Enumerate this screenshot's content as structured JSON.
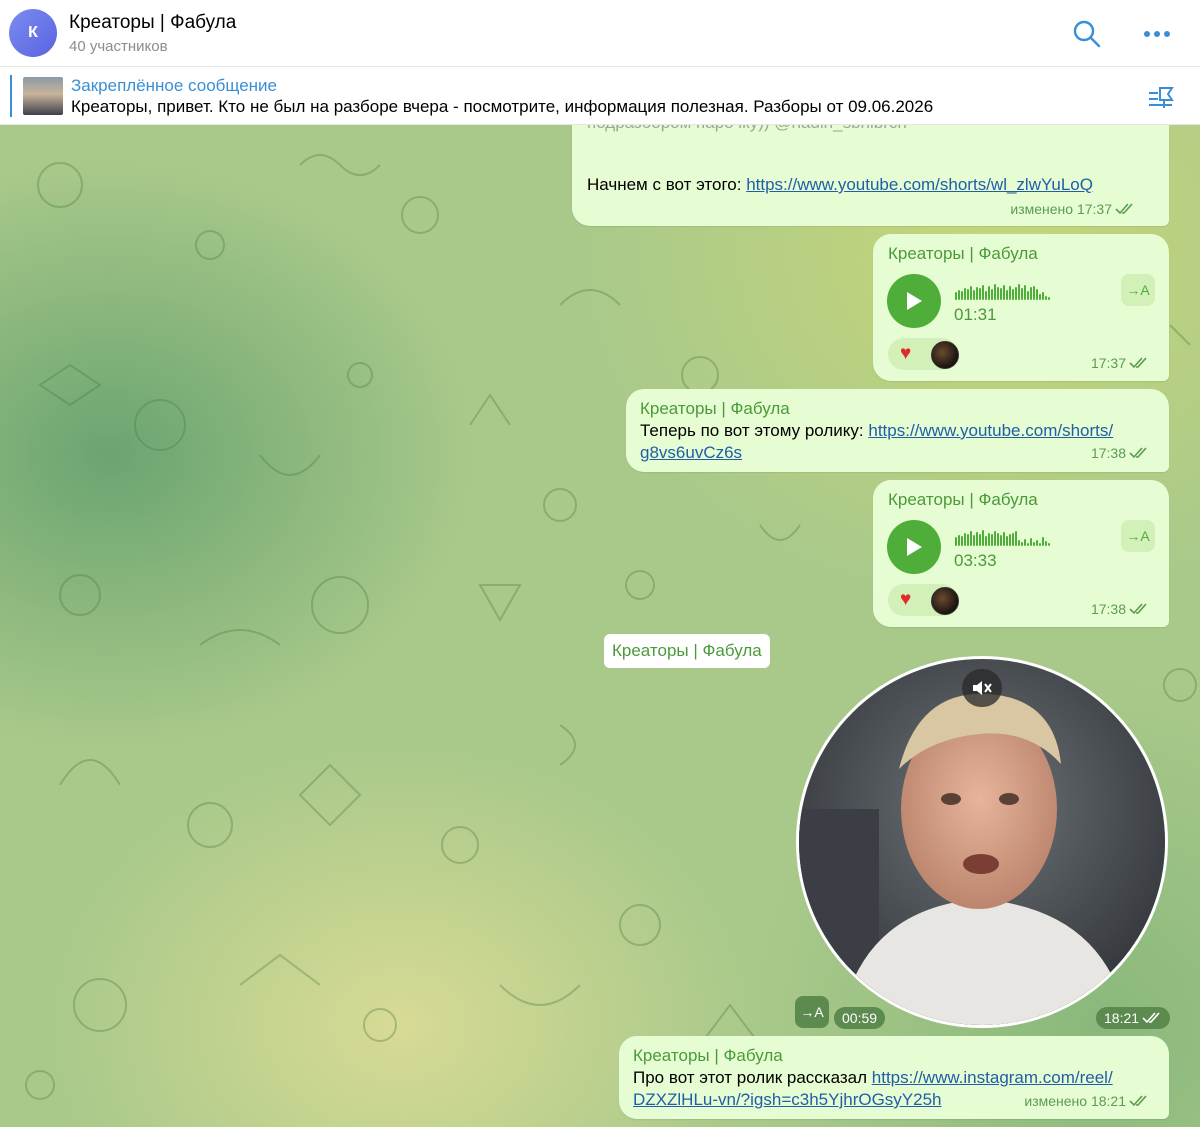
{
  "header": {
    "avatar_letter": "К",
    "title": "Креаторы | Фабула",
    "subtitle": "40 участников",
    "search_icon": "search-icon",
    "more_icon": "more-icon"
  },
  "pinned": {
    "title": "Закреплённое сообщение",
    "text": "Креаторы, привет. Кто не был на разборе вчера - посмотрите, информация полезная. Разборы от 09.06.2026",
    "icon": "unpin-icon"
  },
  "messages": {
    "m1": {
      "partial_line": "подразбором парочку)) @nadin_sbnibrch",
      "prefix": "Начнем с вот этого: ",
      "link": "https://www.youtube.com/shorts/wl_zlwYuLoQ",
      "meta": "изменено 17:37"
    },
    "m2": {
      "sender": "Креаторы | Фабула",
      "duration": "01:31",
      "transcribe": "→A",
      "time": "17:37"
    },
    "m3": {
      "sender": "Креаторы | Фабула",
      "prefix": "Теперь по вот этому ролику: ",
      "link_a": "https://www.youtube.com/shorts/",
      "link_b": "g8vs6uvCz6s",
      "time": "17:38"
    },
    "m4": {
      "sender": "Креаторы | Фабула",
      "duration": "03:33",
      "transcribe": "→A",
      "time": "17:38"
    },
    "m5": {
      "sender": "Креаторы | Фабула",
      "transcribe": "→A",
      "duration": "00:59",
      "time": "18:21"
    },
    "m6": {
      "sender": "Креаторы | Фабула",
      "prefix": "Про вот этот ролик рассказал ",
      "link_a": "https://www.instagram.com/reel/",
      "link_b": "DZXZlHLu-vn/?igsh=c3h5YjhrOGsyY25h",
      "meta": "изменено 18:21"
    }
  },
  "colors": {
    "accent_blue": "#3a8ed6",
    "bubble": "#e6fcd2",
    "green": "#4fae3a",
    "link": "#1f5fa8"
  }
}
